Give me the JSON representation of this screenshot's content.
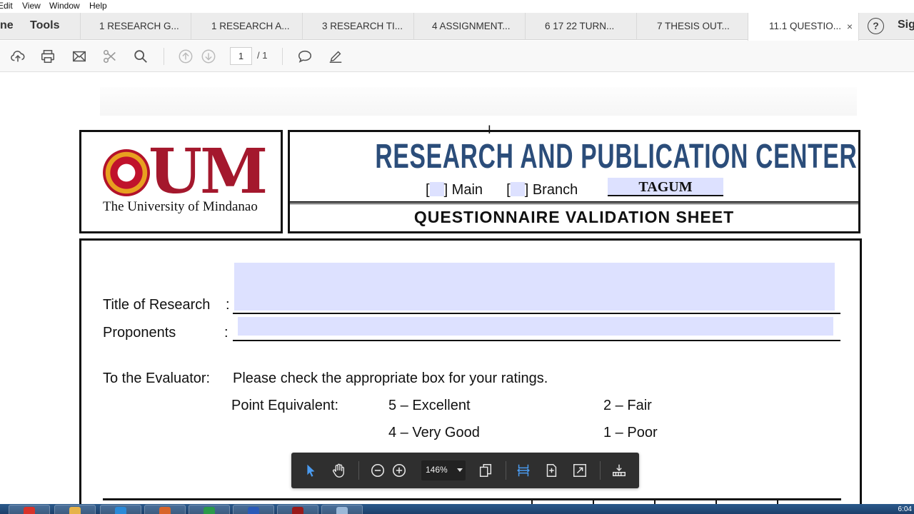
{
  "menu": {
    "items": [
      "Edit",
      "View",
      "Window",
      "Help"
    ]
  },
  "nav": {
    "home_label": "ne",
    "tools_label": "Tools",
    "sign_label": "Sig"
  },
  "tabs": [
    {
      "label": "1 RESEARCH G..."
    },
    {
      "label": "1 RESEARCH A..."
    },
    {
      "label": "3 RESEARCH TI..."
    },
    {
      "label": "4 ASSIGNMENT..."
    },
    {
      "label": "6  17 22 TURN..."
    },
    {
      "label": "7  THESIS OUT..."
    },
    {
      "label": "11.1 QUESTIO...",
      "active": true,
      "close": "×"
    }
  ],
  "toolbar": {
    "icons": [
      "upload-icon",
      "print-icon",
      "mail-icon",
      "scissors-icon",
      "search-icon",
      "page-up-icon",
      "page-down-icon",
      "comment-icon",
      "pen-icon"
    ],
    "page_current": "1",
    "page_total": "/ 1"
  },
  "document": {
    "logo": {
      "text": "UM",
      "university": "The University of Mindanao"
    },
    "center_title": "RESEARCH AND PUBLICATION CENTER",
    "campus": {
      "bracket_open": "[",
      "main_label": "] Main",
      "branch_label": "] Branch",
      "value": "TAGUM"
    },
    "sheet_title": "QUESTIONNAIRE VALIDATION SHEET",
    "title_label": "Title of Research",
    "proponents_label": "Proponents",
    "colon": ":",
    "evaluator_label": "To the Evaluator:",
    "evaluator_instruction": "Please check the appropriate box for your ratings.",
    "point_equivalent_label": "Point Equivalent:",
    "ratings": [
      "5 – Excellent",
      "4 – Very Good",
      "2 – Fair",
      "1 – Poor"
    ]
  },
  "float_toolbar": {
    "zoom": "146%",
    "icons": [
      "select-arrow-icon",
      "hand-icon",
      "zoom-out-icon",
      "zoom-in-icon",
      "rotate-pages-icon",
      "fit-width-icon",
      "fit-page-icon",
      "fullscreen-icon",
      "read-mode-icon"
    ]
  },
  "colors": {
    "accent_blue": "#2b4d7a",
    "um_red": "#a4182d",
    "field_fill": "#dde1ff"
  },
  "taskbar": {
    "clock": "6:04"
  }
}
